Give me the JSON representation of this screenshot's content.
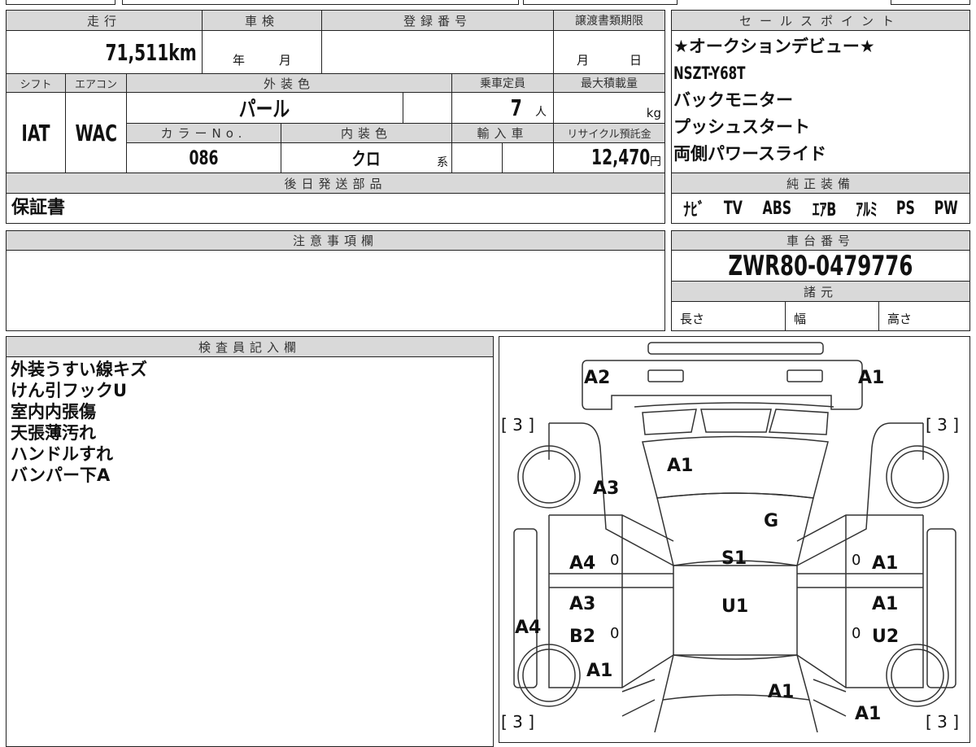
{
  "header_labels": {
    "mileage": "走行",
    "inspection": "車検",
    "registration": "登録番号",
    "transfer_deadline": "譲渡書類期限",
    "shift": "シフト",
    "aircon": "エアコン",
    "exterior_color": "外装色",
    "capacity": "乗車定員",
    "max_load": "最大積載量",
    "color_no": "カラーNo.",
    "interior_color": "内装色",
    "import": "輸入車",
    "recycle_fee": "リサイクル預託金",
    "later_parts": "後日発送部品",
    "sales_points": "セールスポイント",
    "equipment": "純正装備",
    "notes": "注意事項欄",
    "chassis": "車台番号",
    "specs": "諸元",
    "inspector": "検査員記入欄"
  },
  "values": {
    "mileage": "71,511",
    "mileage_unit": "km",
    "inspection_year": "年",
    "inspection_month": "月",
    "deadline_month": "月",
    "deadline_day": "日",
    "shift": "IAT",
    "aircon": "WAC",
    "exterior_color": "パール",
    "capacity": "7",
    "capacity_unit": "人",
    "load_unit": "kg",
    "color_no": "086",
    "interior_color": "クロ",
    "interior_suffix": "系",
    "recycle_fee": "12,470",
    "recycle_unit": "円",
    "later_parts": "保証書",
    "chassis": "ZWR80-0479776",
    "length": "長さ",
    "width": "幅",
    "height": "高さ"
  },
  "sales_points": [
    "★オークションデビュー★",
    "NSZT-Y68T",
    "バックモニター",
    "プッシュスタート",
    "両側パワースライド"
  ],
  "equipment": [
    "ﾅﾋﾞ",
    "TV",
    "ABS",
    "ｴｱB",
    "ｱﾙﾐ",
    "PS",
    "PW"
  ],
  "inspector_notes": [
    "外装うすい線キズ",
    "けん引フックU",
    "室内内張傷",
    "天張薄汚れ",
    "ハンドルすれ",
    "バンパー下A"
  ],
  "diagram": {
    "tire_marks": [
      "[ 3 ]",
      "[ 3 ]",
      "[ 3 ]",
      "[ 3 ]"
    ],
    "zero": "0",
    "marks": {
      "front_bumper_left": "A2",
      "front_bumper_right": "A1",
      "hood": "A1",
      "front_fender_left": "A3",
      "windshield": "G",
      "roof": "S1",
      "front_door_left": "A4",
      "front_door_right": "A1",
      "rear_door_left": "A3",
      "roof_rear": "U1",
      "rear_door_right": "A1",
      "rocker_left": "A4",
      "rear_door_left_2": "B2",
      "rear_door_right_2": "U2",
      "rear_fender_left": "A1",
      "back_door": "A1",
      "rear_fender_right": "A1"
    }
  }
}
